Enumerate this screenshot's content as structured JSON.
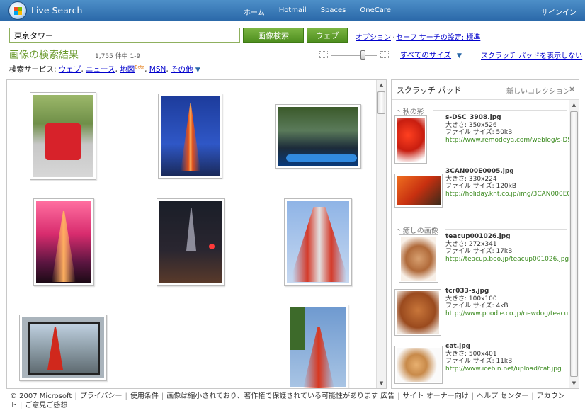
{
  "topbar": {
    "brand": "Live Search",
    "nav": [
      "ホーム",
      "Hotmail",
      "Spaces",
      "OneCare"
    ],
    "signin": "サインイン"
  },
  "search": {
    "query": "東京タワー",
    "image_button": "画像検索",
    "web_button": "ウェブ",
    "options": "オプション",
    "separator": "·",
    "safesearch": "セーフ サーチの設定: 標準"
  },
  "results_header": {
    "title": "画像の検索結果",
    "count": "1,755 件中 1-9",
    "services_label": "検索サービス: ",
    "services": [
      "ウェブ",
      "ニュース",
      "地図",
      "MSN",
      "その他"
    ],
    "beta": "Beta",
    "all_sizes": "すべてのサイズ",
    "hide_scratch": "スクラッチ パッドを表示しない",
    "size_slider_level": 0.68
  },
  "scratchpad": {
    "title": "スクラッチ パッド",
    "new_collection": "新しいコレクション",
    "close": "×",
    "groups": [
      {
        "name": "秋の彩",
        "items": [
          {
            "file": "s-DSC_3908.jpg",
            "size": "大きさ: 350x526",
            "filesize": "ファイル サイズ: 50kB",
            "url": "http://www.remodeya.com/weblog/s-DS..."
          },
          {
            "file": "3CAN000E0005.jpg",
            "size": "大きさ: 330x224",
            "filesize": "ファイル サイズ: 120kB",
            "url": "http://holiday.knt.co.jp/img/3CAN000E000..."
          }
        ]
      },
      {
        "name": "癒しの画像",
        "items": [
          {
            "file": "teacup001026.jpg",
            "size": "大きさ: 272x341",
            "filesize": "ファイル サイズ: 17kB",
            "url": "http://teacup.boo.jp/teacup001026.jpg"
          },
          {
            "file": "tcr033-s.jpg",
            "size": "大きさ: 100x100",
            "filesize": "ファイル サイズ: 4kB",
            "url": "http://www.poodle.co.jp/newdog/teacup/..."
          },
          {
            "file": "cat.jpg",
            "size": "大きさ: 500x401",
            "filesize": "ファイル サイズ: 11kB",
            "url": "http://www.icebin.net/upload/cat.jpg"
          }
        ]
      }
    ]
  },
  "footer": {
    "copyright": "© 2007 Microsoft",
    "links": [
      "プライバシー",
      "使用条件",
      "画像は縮小されており、著作権で保護されている可能性があります",
      "広告",
      "サイト オーナー向け",
      "ヘルプ センター",
      "アカウント",
      "ご意見ご感想"
    ]
  },
  "icons": {
    "logo": "windows-live-icon",
    "close": "close-icon",
    "collapse": "triangle-down-icon",
    "scroll_up": "scroll-up-arrow-icon",
    "scroll_down": "scroll-down-arrow-icon",
    "small_size": "small-grid-icon",
    "large_size": "large-grid-icon"
  }
}
